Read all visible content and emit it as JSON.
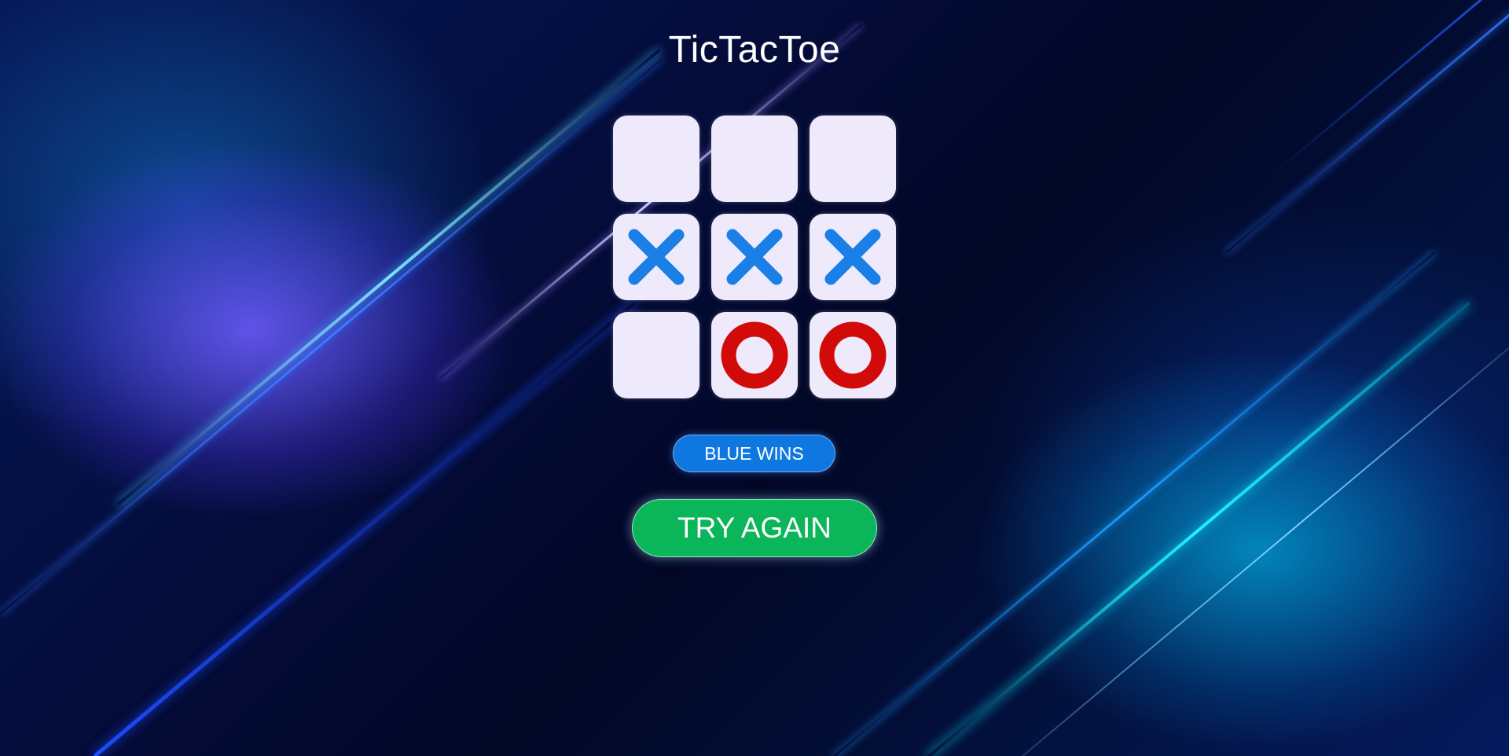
{
  "title": "TicTacToe",
  "board": [
    [
      "",
      "",
      ""
    ],
    [
      "X",
      "X",
      "X"
    ],
    [
      "",
      "O",
      "O"
    ]
  ],
  "status": "BLUE WINS",
  "try_again_label": "TRY AGAIN",
  "colors": {
    "x_mark": "#1a7fe6",
    "o_mark": "#d30a0a",
    "cell": "#eeeafb",
    "status_bg": "#0f78e0",
    "button_bg": "#0bb55a"
  }
}
